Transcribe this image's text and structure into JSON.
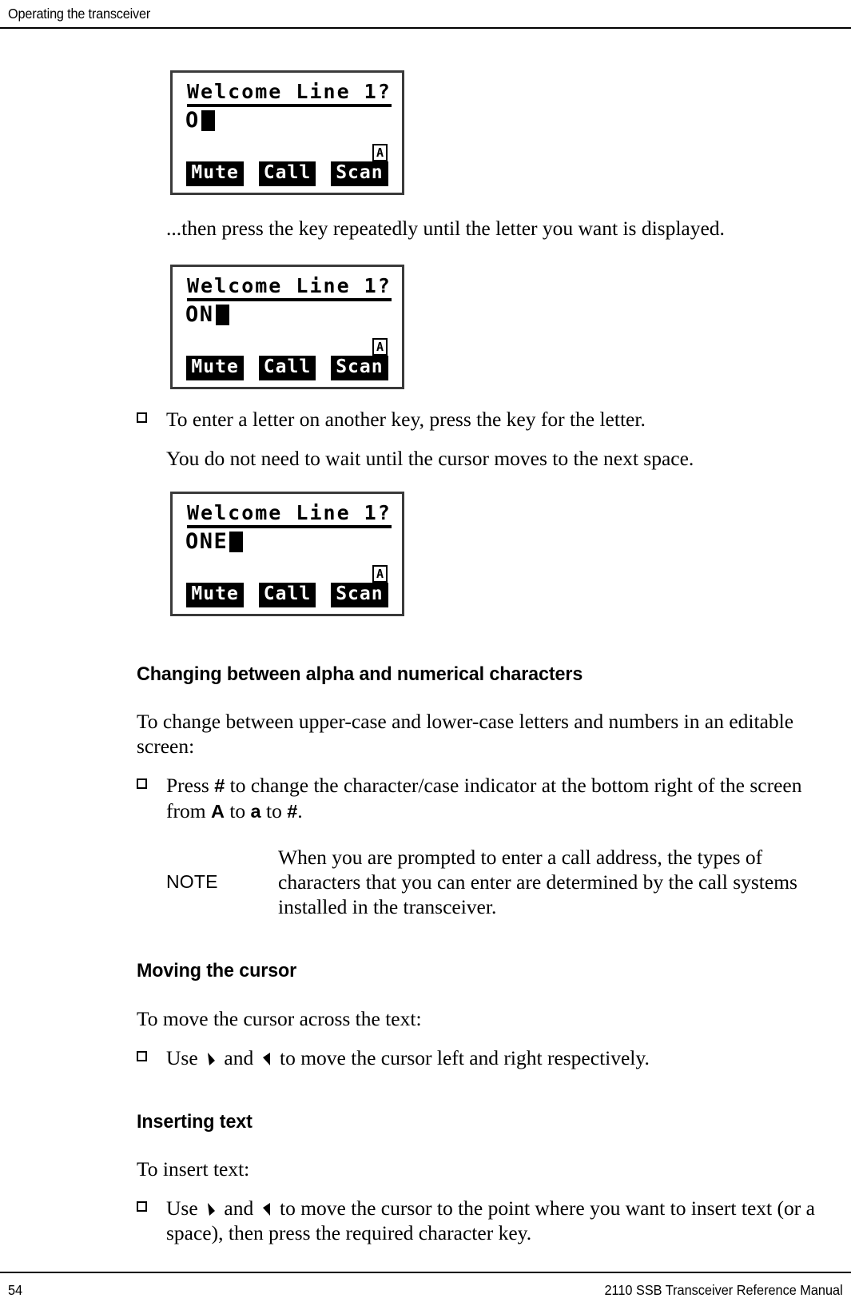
{
  "header": {
    "running_head": "Operating the transceiver"
  },
  "lcd_screens": [
    {
      "title": "Welcome Line 1?",
      "entry_text": "O",
      "case_indicator": "A",
      "softkeys": [
        "Mute",
        "Call",
        "Scan"
      ]
    },
    {
      "title": "Welcome Line 1?",
      "entry_text": "ON",
      "case_indicator": "A",
      "softkeys": [
        "Mute",
        "Call",
        "Scan"
      ]
    },
    {
      "title": "Welcome Line 1?",
      "entry_text": "ONE",
      "case_indicator": "A",
      "softkeys": [
        "Mute",
        "Call",
        "Scan"
      ]
    }
  ],
  "body": {
    "caption_after_first_screen": "...then press the key repeatedly until the letter you want is displayed.",
    "bullet_another_key": "To enter a letter on another key, press the key for the letter.",
    "para_no_wait": "You do not need to wait until the cursor moves to the next space."
  },
  "section_alpha_numeric": {
    "heading": "Changing between alpha and numerical characters",
    "intro": "To change between upper-case and lower-case letters and numbers in an editable screen:",
    "bullet_pre": "Press ",
    "bullet_key": "#",
    "bullet_mid": " to change the character/case indicator at the bottom right of the screen from ",
    "bullet_val_a_upper": "A",
    "bullet_to_1": " to ",
    "bullet_val_a_lower": "a",
    "bullet_to_2": " to ",
    "bullet_val_hash": "#",
    "bullet_end": ".",
    "note_label": "NOTE",
    "note_text": "When you are prompted to enter a call address, the types of characters that you can enter are determined by the call systems installed in the transceiver."
  },
  "section_moving_cursor": {
    "heading": "Moving the cursor",
    "intro": "To move the cursor across the text:",
    "bullet_pre": "Use ",
    "bullet_mid": " and ",
    "bullet_post": " to move the cursor left and right respectively.",
    "icon_left": "arrow-right-glyph",
    "icon_right": "arrow-left-glyph"
  },
  "section_inserting_text": {
    "heading": "Inserting text",
    "intro": "To insert text:",
    "bullet_pre": "Use ",
    "bullet_mid": " and ",
    "bullet_post": " to move the cursor to the point where you want to insert text (or a space), then press the required character key."
  },
  "footer": {
    "page_number": "54",
    "manual_title": "2110 SSB Transceiver Reference Manual"
  }
}
